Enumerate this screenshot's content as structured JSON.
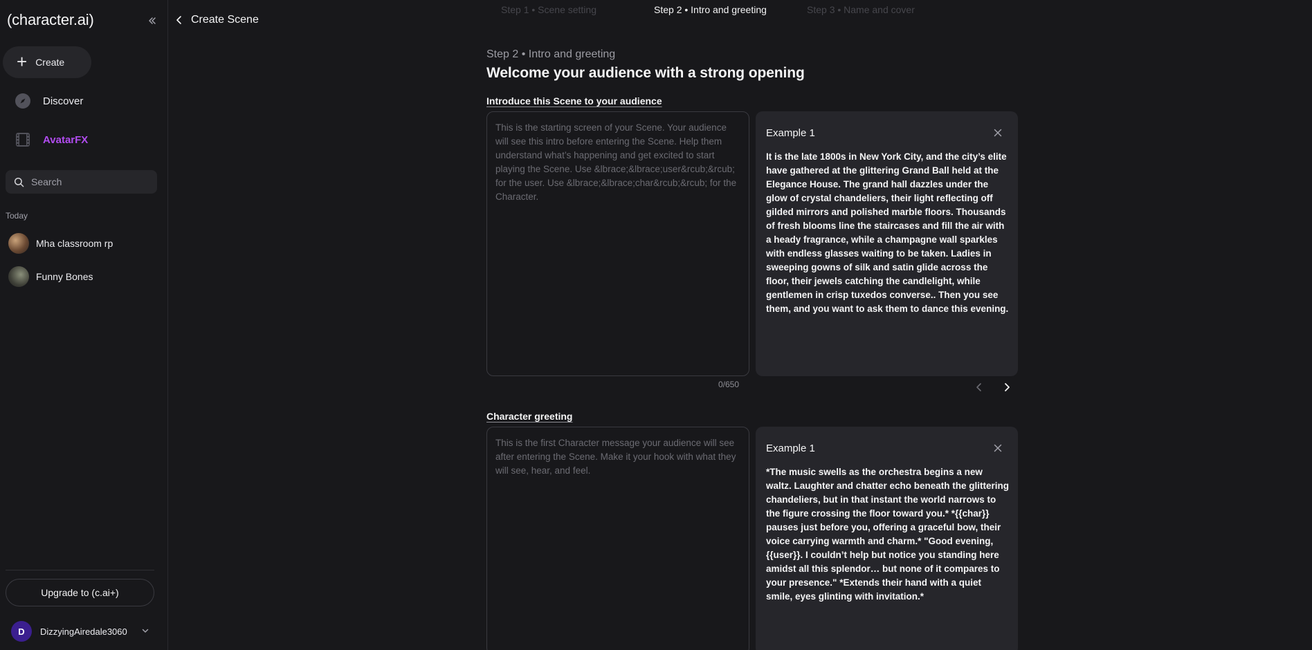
{
  "sidebar": {
    "logo": "(character.ai)",
    "create_label": "Create",
    "nav": [
      {
        "label": "Discover",
        "icon": "compass-icon"
      },
      {
        "label": "AvatarFX",
        "icon": "film-icon",
        "accent": "#b14cf0"
      }
    ],
    "search_placeholder": "Search",
    "section_today": "Today",
    "chats": [
      {
        "name": "Mha classroom rp"
      },
      {
        "name": "Funny Bones"
      }
    ],
    "upgrade_label": "Upgrade to (c.ai+)",
    "user": {
      "initial": "D",
      "name": "DizzyingAiredale3060"
    }
  },
  "header": {
    "back_label": "Create Scene"
  },
  "steps": [
    {
      "label": "Step 1 • Scene setting",
      "state": "inactive"
    },
    {
      "label": "Step 2 • Intro and greeting",
      "state": "active"
    },
    {
      "label": "Step 3 • Name and cover",
      "state": "inactive"
    }
  ],
  "main": {
    "eyebrow": "Step 2 • Intro and greeting",
    "headline": "Welcome your audience with a strong opening",
    "intro": {
      "label": "Introduce this Scene to your audience",
      "placeholder": "This is the starting screen of your Scene. Your audience will see this intro before entering the Scene. Help them understand what’s happening and get excited to start playing the Scene. Use &lbrace;&lbrace;user&rcub;&rcub; for the user. Use &lbrace;&lbrace;char&rcub;&rcub; for the Character.",
      "char_count": "0/650",
      "example_title": "Example 1",
      "example_text": "It is the late 1800s in New York City, and the city’s elite have gathered at the glittering Grand Ball held at the Elegance House. The grand hall dazzles under the glow of crystal chandeliers, their light reflecting off gilded mirrors and polished marble floors. Thousands of fresh blooms line the staircases and fill the air with a heady fragrance, while a champagne wall sparkles with endless glasses waiting to be taken. Ladies in sweeping gowns of silk and satin glide across the floor, their jewels catching the candlelight, while gentlemen in crisp tuxedos converse.. Then you see them, and you want to ask them to dance this evening."
    },
    "greeting": {
      "label": "Character greeting",
      "placeholder": "This is the first Character message your audience will see after entering the Scene. Make it your hook with what they will see, hear, and feel.",
      "example_title": "Example 1",
      "example_text": "*The music swells as the orchestra begins a new waltz. Laughter and chatter echo beneath the glittering chandeliers, but in that instant the world narrows to the figure crossing the floor toward you.* *{{char}} pauses just before you, offering a graceful bow, their voice carrying warmth and charm.* \"Good evening, {{user}}. I couldn’t help but notice you standing here amidst all this splendor… but none of it compares to your presence.\" *Extends their hand with a quiet smile, eyes glinting with invitation.*"
    }
  }
}
